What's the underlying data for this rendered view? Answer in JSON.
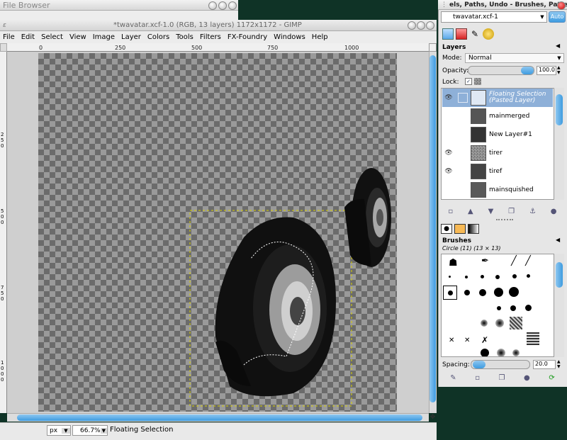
{
  "file_browser": {
    "title": "File Browser"
  },
  "image_window": {
    "title": "*twavatar.xcf-1.0 (RGB, 13 layers) 1172x1172 - GIMP",
    "menu": [
      "File",
      "Edit",
      "Select",
      "View",
      "Image",
      "Layer",
      "Colors",
      "Tools",
      "Filters",
      "FX-Foundry",
      "Windows",
      "Help"
    ],
    "ruler_labels": [
      "0",
      "250",
      "500",
      "750",
      "1000"
    ],
    "vruler_labels": [
      "2 5 0",
      "5 0 0",
      "7 5 0",
      "1 0 0 0"
    ],
    "status": {
      "unit": "px",
      "zoom": "66.7%",
      "message": "Floating Selection"
    }
  },
  "dock": {
    "title": "els, Paths, Undo - Brushes, Patter",
    "image_select": "twavatar.xcf-1",
    "auto_button": "Auto",
    "layers": {
      "header": "Layers",
      "mode_label": "Mode:",
      "mode_value": "Normal",
      "opacity_label": "Opacity:",
      "opacity_value": "100.0",
      "lock_label": "Lock:",
      "items": [
        {
          "name": "Floating Selection",
          "sub": "(Pasted Layer)",
          "visible": true,
          "selected": true
        },
        {
          "name": "mainmerged",
          "visible": false
        },
        {
          "name": "New Layer#1",
          "visible": false
        },
        {
          "name": "tirer",
          "visible": true
        },
        {
          "name": "tiref",
          "visible": true
        },
        {
          "name": "mainsquished",
          "visible": false
        }
      ]
    },
    "brushes": {
      "header": "Brushes",
      "current": "Circle (11) (13 × 13)",
      "spacing_label": "Spacing:",
      "spacing_value": "20.0"
    }
  }
}
